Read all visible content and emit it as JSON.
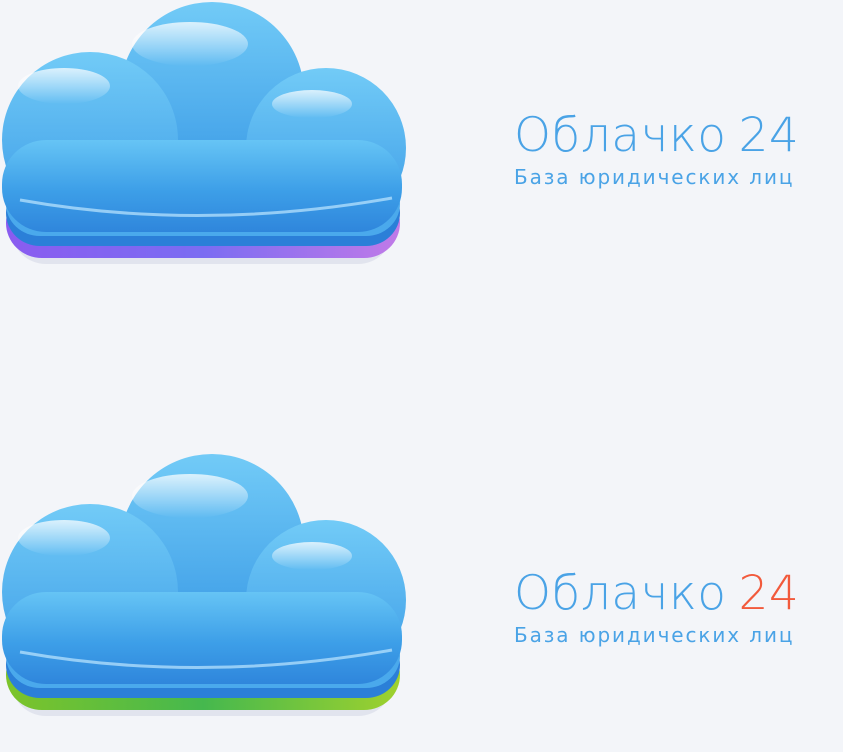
{
  "variants": [
    {
      "brand_name": "Облачко",
      "brand_number": "24",
      "tagline": "База юридических лиц",
      "text_color": "#4aa3e6",
      "number_color": "#4aa3e6",
      "base_color": "purple"
    },
    {
      "brand_name": "Облачко",
      "brand_number": "24",
      "tagline": "База юридических лиц",
      "text_color": "#4aa3e6",
      "number_color": "#f25a3c",
      "base_color": "green"
    }
  ]
}
